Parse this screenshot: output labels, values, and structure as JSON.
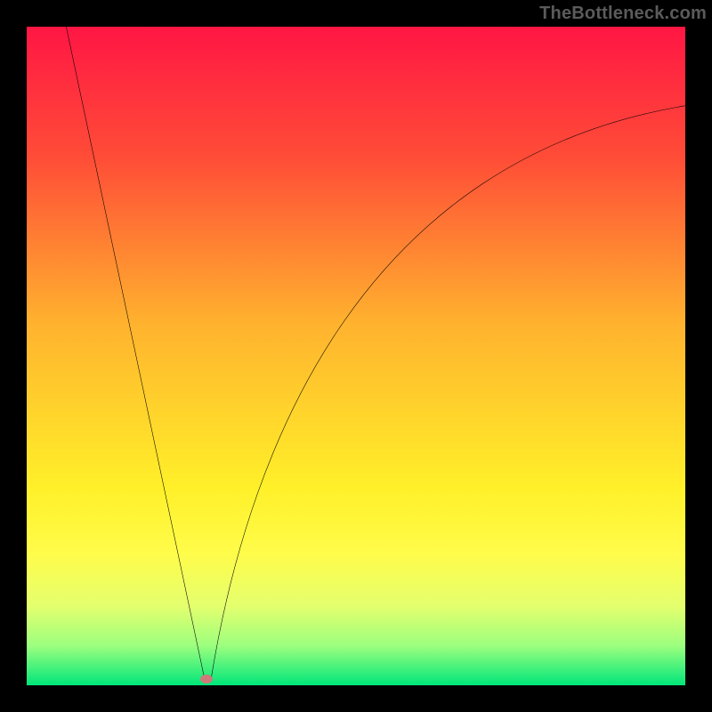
{
  "watermark_text": "TheBottleneck.com",
  "chart_data": {
    "type": "line",
    "title": "",
    "xlabel": "",
    "ylabel": "",
    "x_range": [
      0,
      100
    ],
    "y_range": [
      0,
      100
    ],
    "grid": false,
    "gradient_stops": [
      {
        "offset": 0,
        "color": "#ff1644"
      },
      {
        "offset": 20,
        "color": "#ff4d37"
      },
      {
        "offset": 45,
        "color": "#ffb22e"
      },
      {
        "offset": 70,
        "color": "#fff029"
      },
      {
        "offset": 80,
        "color": "#fffc4a"
      },
      {
        "offset": 88,
        "color": "#e4ff6e"
      },
      {
        "offset": 94,
        "color": "#9cff7e"
      },
      {
        "offset": 100,
        "color": "#00e67a"
      }
    ],
    "series": [
      {
        "name": "bottleneck-curve",
        "segments": [
          {
            "kind": "line",
            "from": {
              "x": 6,
              "y": 100
            },
            "to": {
              "x": 27,
              "y": 1
            }
          },
          {
            "kind": "curve",
            "from": {
              "x": 28,
              "y": 1
            },
            "control1": {
              "x": 34,
              "y": 38
            },
            "control2": {
              "x": 52,
              "y": 80
            },
            "to": {
              "x": 100,
              "y": 88
            }
          }
        ]
      }
    ],
    "minimum_point": {
      "x": 27.3,
      "y": 1
    },
    "annotations": []
  }
}
